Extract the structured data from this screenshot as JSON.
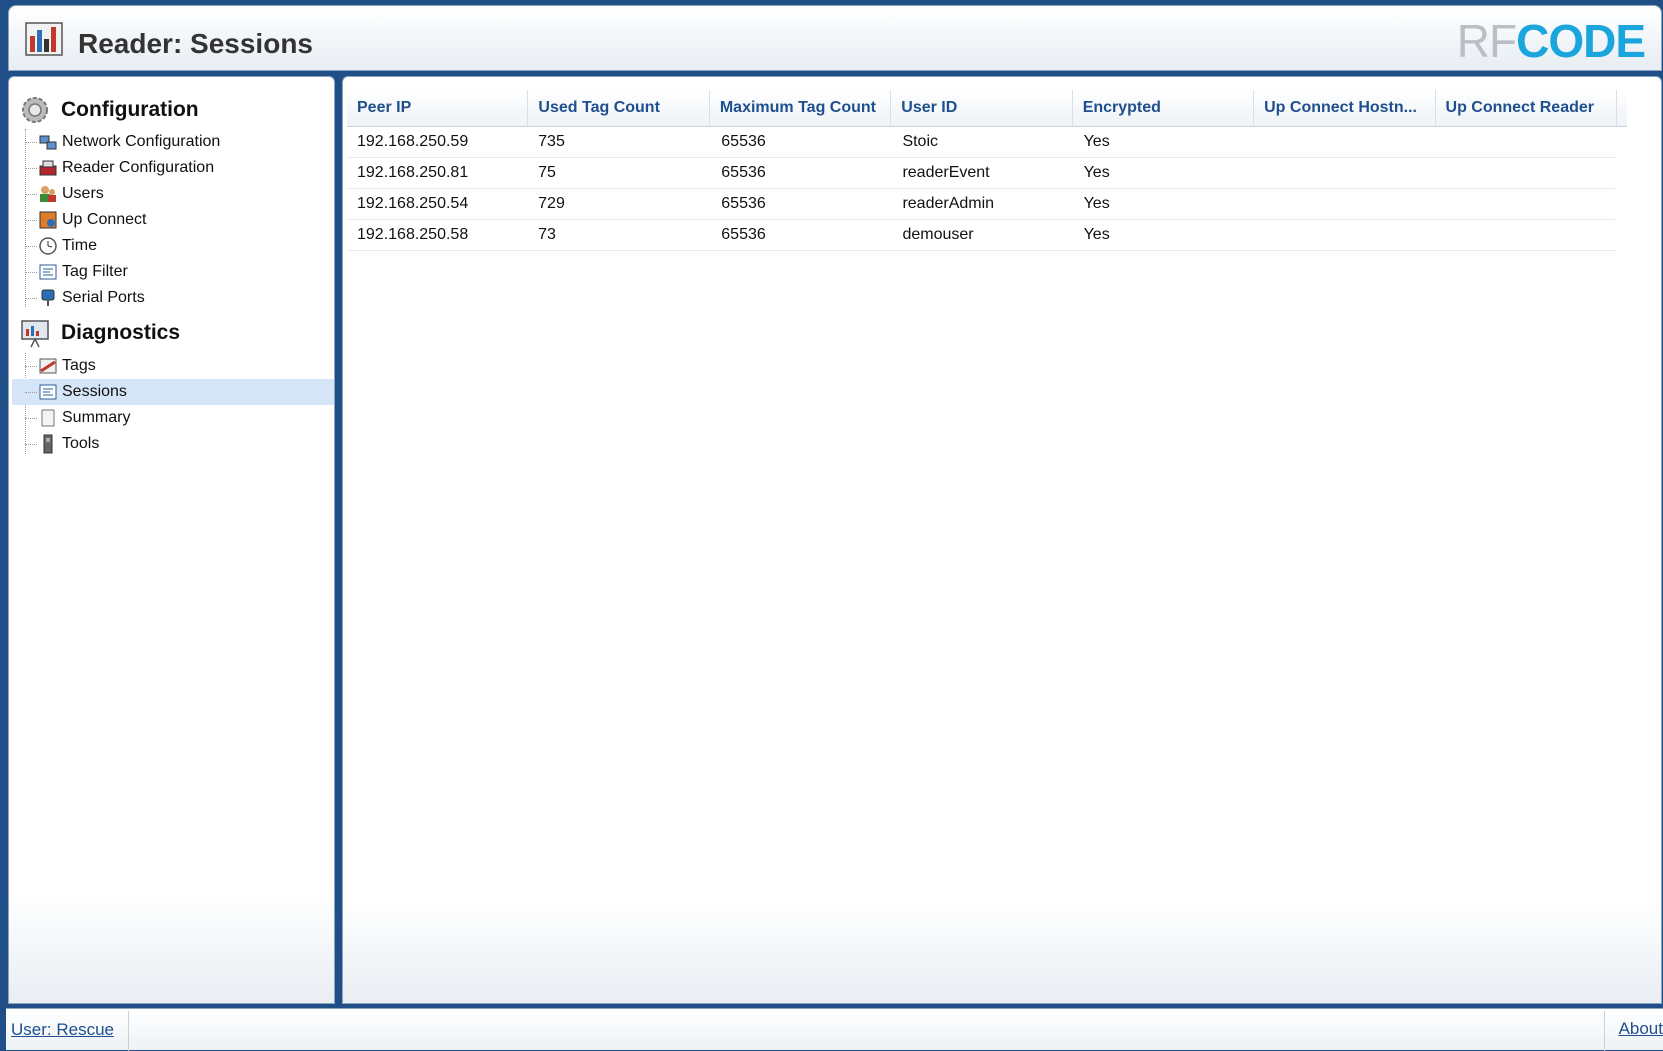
{
  "header": {
    "title": "Reader: Sessions",
    "logo_left": "RF",
    "logo_right": "CODE"
  },
  "sidebar": {
    "sections": [
      {
        "label": "Configuration",
        "icon": "gear-icon",
        "items": [
          {
            "label": "Network Configuration",
            "icon": "network-icon"
          },
          {
            "label": "Reader Configuration",
            "icon": "reader-icon"
          },
          {
            "label": "Users",
            "icon": "users-icon"
          },
          {
            "label": "Up Connect",
            "icon": "up-connect-icon"
          },
          {
            "label": "Time",
            "icon": "clock-icon"
          },
          {
            "label": "Tag Filter",
            "icon": "filter-list-icon"
          },
          {
            "label": "Serial Ports",
            "icon": "serial-port-icon"
          }
        ]
      },
      {
        "label": "Diagnostics",
        "icon": "diagnostics-monitor-icon",
        "items": [
          {
            "label": "Tags",
            "icon": "tag-icon"
          },
          {
            "label": "Sessions",
            "icon": "sessions-list-icon",
            "selected": true
          },
          {
            "label": "Summary",
            "icon": "document-icon"
          },
          {
            "label": "Tools",
            "icon": "tools-icon"
          }
        ]
      }
    ]
  },
  "grid": {
    "columns": [
      "Peer IP",
      "Used Tag Count",
      "Maximum Tag Count",
      "User ID",
      "Encrypted",
      "Up Connect Hostn...",
      "Up Connect Reader"
    ],
    "rows": [
      [
        "192.168.250.59",
        "735",
        "65536",
        "Stoic",
        "Yes",
        "",
        ""
      ],
      [
        "192.168.250.81",
        "75",
        "65536",
        "readerEvent",
        "Yes",
        "",
        ""
      ],
      [
        "192.168.250.54",
        "729",
        "65536",
        "readerAdmin",
        "Yes",
        "",
        ""
      ],
      [
        "192.168.250.58",
        "73",
        "65536",
        "demouser",
        "Yes",
        "",
        ""
      ]
    ]
  },
  "footer": {
    "user_label": "User: Rescue",
    "about_label": "About"
  },
  "colors": {
    "frame": "#1f4f86",
    "header_text": "#1e4f8e",
    "selected_row": "#d6e6f8",
    "logo_grey": "#b9bfc6",
    "logo_blue": "#1aa6dd"
  }
}
